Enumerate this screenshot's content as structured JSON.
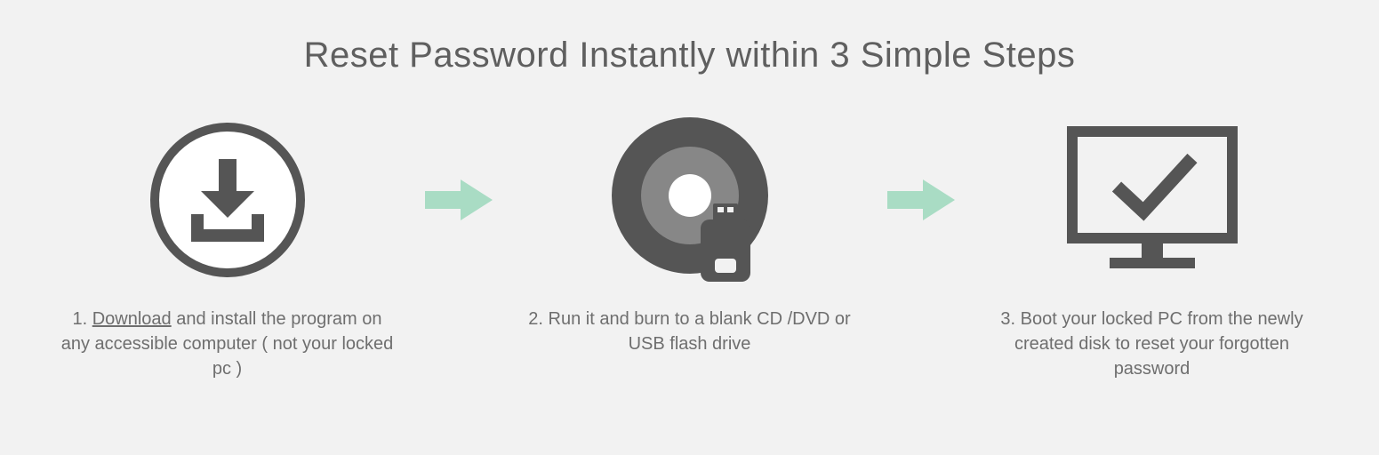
{
  "title": "Reset Password Instantly within 3 Simple Steps",
  "steps": [
    {
      "num": "1.",
      "link": "Download",
      "rest": " and install the program on any accessible computer ( not your locked pc )"
    },
    {
      "num": "2.",
      "rest": " Run it and burn to a blank CD /DVD or USB flash drive"
    },
    {
      "num": "3.",
      "rest": " Boot your locked PC from the newly created disk to reset your forgotten password"
    }
  ]
}
